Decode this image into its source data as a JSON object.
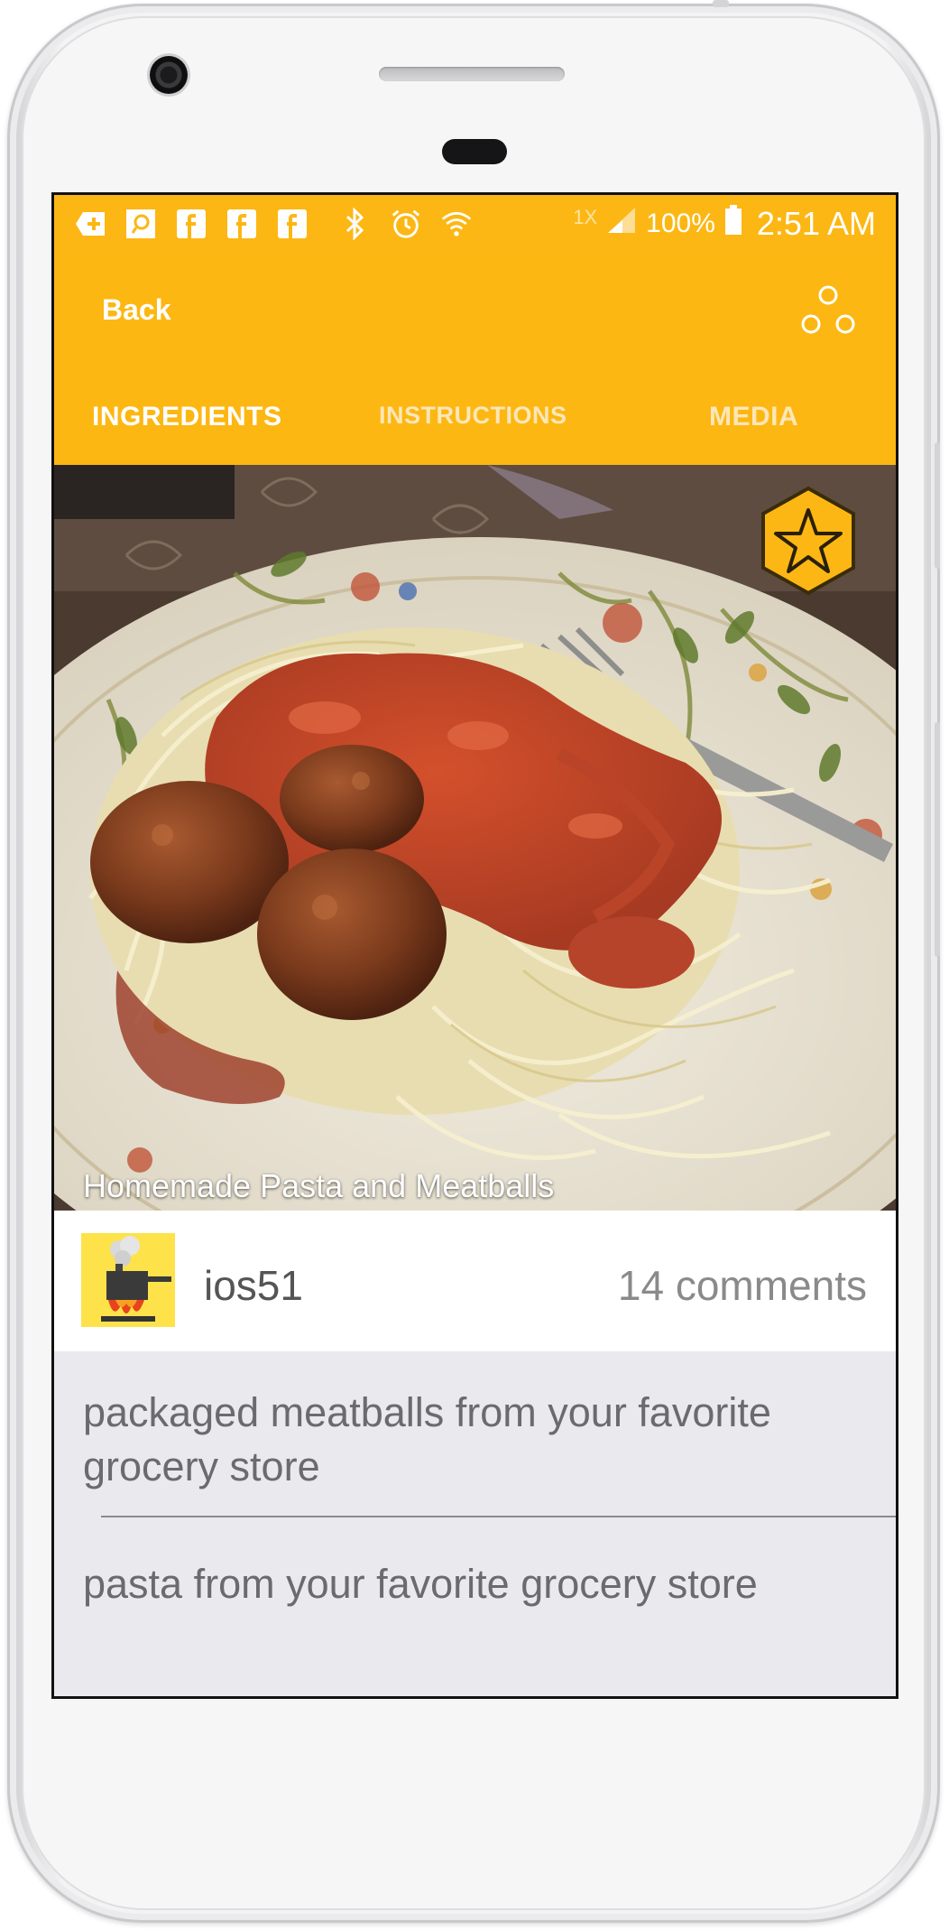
{
  "status_bar": {
    "icons": [
      "plus-icon",
      "app-box-icon",
      "facebook-icon",
      "facebook-icon",
      "facebook-icon",
      "bluetooth-icon",
      "alarm-icon",
      "wifi-icon"
    ],
    "network": "1X",
    "battery": "100%",
    "time": "2:51 AM"
  },
  "header": {
    "back_label": "Back",
    "share_icon": "share-icon"
  },
  "tabs": [
    {
      "label": "INGREDIENTS",
      "active": true
    },
    {
      "label": "INSTRUCTIONS",
      "active": false
    },
    {
      "label": "MEDIA",
      "active": false
    }
  ],
  "recipe": {
    "title": "Homemade Pasta and Meatballs",
    "favorite_icon": "star-icon",
    "author": "ios51",
    "comments": "14 comments"
  },
  "ingredients": [
    "packaged meatballs from your favorite grocery store",
    "pasta from your favorite grocery store"
  ],
  "colors": {
    "accent": "#fdb713",
    "status_bar": "#fcb714",
    "list_bg": "#e9e9ee",
    "ingredient_text": "#6a6a70"
  }
}
